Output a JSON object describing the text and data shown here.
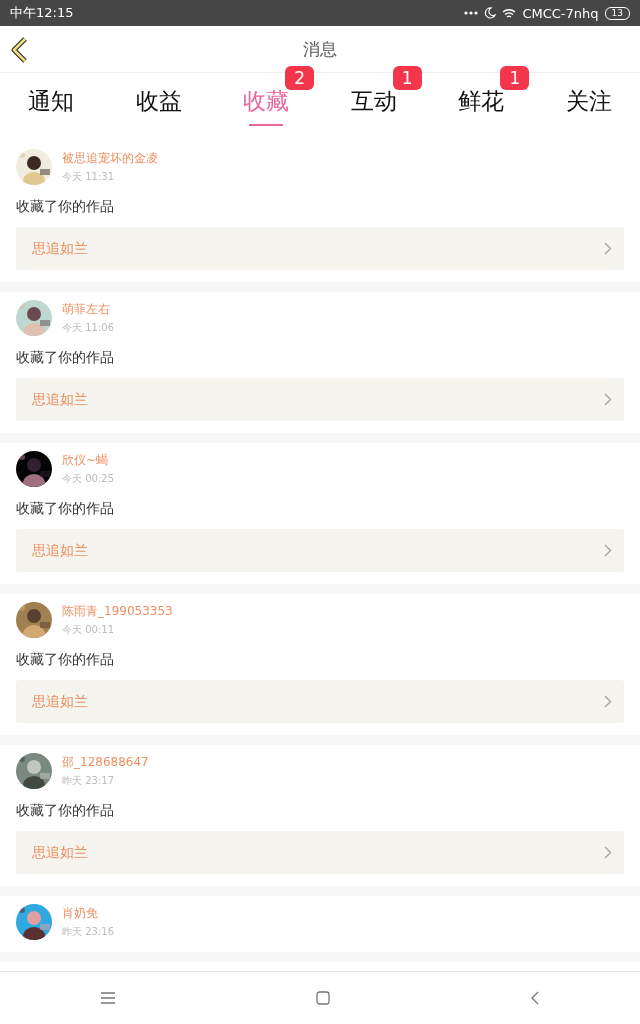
{
  "status_bar": {
    "time": "中午12:15",
    "network": "CMCC-7nhq",
    "battery": "13"
  },
  "header": {
    "title": "消息"
  },
  "tabs": [
    {
      "label": "通知",
      "selected": false
    },
    {
      "label": "收益",
      "selected": false
    },
    {
      "label": "收藏",
      "selected": true,
      "badge": "2"
    },
    {
      "label": "互动",
      "selected": false,
      "badge": "1"
    },
    {
      "label": "鲜花",
      "selected": false,
      "badge": "1"
    },
    {
      "label": "关注",
      "selected": false
    }
  ],
  "messages": [
    {
      "user": "被思追宠坏的金凌",
      "time": "今天 11:31",
      "text": "收藏了你的作品",
      "work": "思追如兰"
    },
    {
      "user": "萌菲左右",
      "time": "今天 11:06",
      "text": "收藏了你的作品",
      "work": "思追如兰"
    },
    {
      "user": "欣仪~蝎",
      "time": "今天 00:25",
      "text": "收藏了你的作品",
      "work": "思追如兰"
    },
    {
      "user": "陈雨青_199053353",
      "time": "今天 00:11",
      "text": "收藏了你的作品",
      "work": "思追如兰"
    },
    {
      "user": "邵_128688647",
      "time": "昨天 23:17",
      "text": "收藏了你的作品",
      "work": "思追如兰"
    },
    {
      "user": "肖奶免",
      "time": "昨天 23:16"
    }
  ]
}
